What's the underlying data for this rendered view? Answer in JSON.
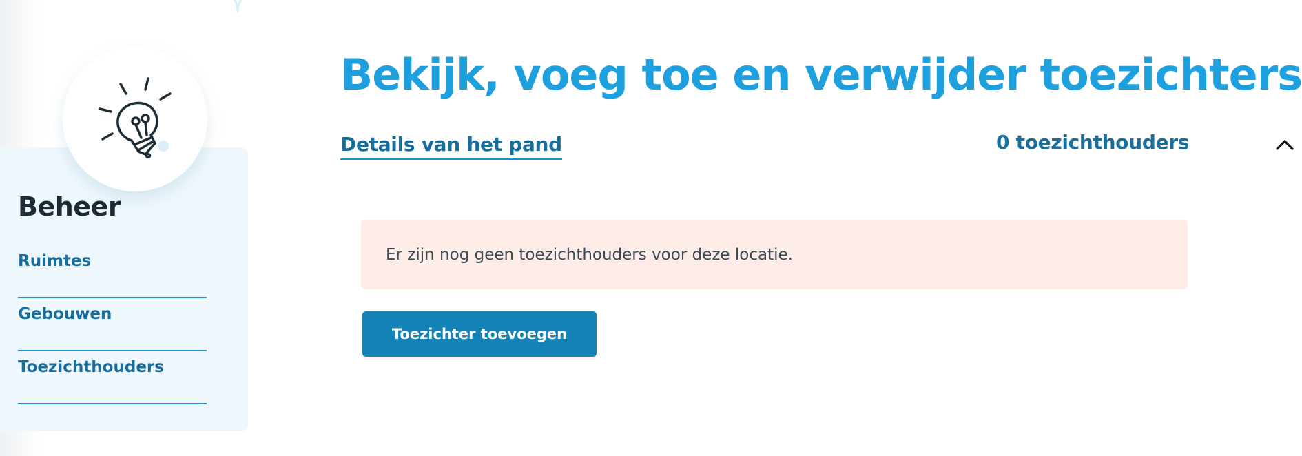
{
  "sidebar": {
    "icon": "lightbulb-icon",
    "title": "Beheer",
    "items": [
      {
        "label": "Ruimtes"
      },
      {
        "label": "Gebouwen"
      },
      {
        "label": "Toezichthouders"
      }
    ]
  },
  "main": {
    "title": "Bekijk, voeg toe en verwijder toezichters",
    "details_tab": "Details van het pand",
    "count_label": "0 toezichthouders",
    "collapse_icon": "chevron-up-icon",
    "alert_text": "Er zijn nog geen toezichthouders voor deze locatie.",
    "add_button": "Toezichter toevoegen"
  },
  "colors": {
    "accent_blue": "#1ea0df",
    "link_blue": "#176d9c",
    "button_blue": "#1582b8",
    "alert_bg": "#fdece7",
    "sidebar_bg": "#eef7fc",
    "dark_text": "#1d2b35"
  }
}
